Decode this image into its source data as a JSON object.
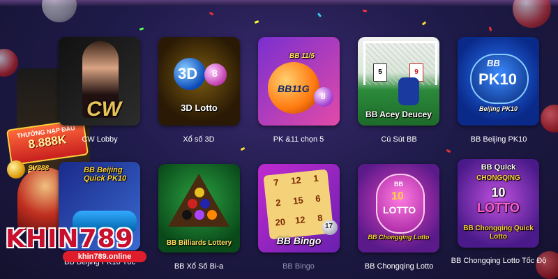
{
  "promo": {
    "line1": "THƯỞNG NẠP ĐẦU",
    "line2": "8.888K",
    "sv_logo": "SV388"
  },
  "games": [
    {
      "label": "CW Lobby",
      "art": "CW",
      "dim": false
    },
    {
      "label": "Xổ số 3D",
      "art": "3D Lotto",
      "dim": false
    },
    {
      "label": "PK &11 chọn 5",
      "art": "BB 11/5",
      "dim": false
    },
    {
      "label": "Cú Sút BB",
      "art": "BB Acey Deucey",
      "dim": false
    },
    {
      "label": "BB Beijing PK10",
      "art": "Beijing PK10",
      "dim": false
    },
    {
      "label": "BB Beijing PK10 Tốc",
      "art": "BB Beijing Quick PK10",
      "dim": false
    },
    {
      "label": "BB Xổ Số Bi-a",
      "art": "BB Billiards Lottery",
      "dim": false
    },
    {
      "label": "BB Bingo",
      "art": "BB Bingo",
      "dim": true
    },
    {
      "label": "BB Chongqing Lotto",
      "art": "BB Chongqing Lotto",
      "dim": false
    },
    {
      "label": "BB Chongqing Lotto Tốc Độ",
      "art": "BB Chongqing Quick Lotto",
      "dim": false
    }
  ],
  "art_extras": {
    "bb115_logo": "BB11G",
    "pk10_logo": "PK10",
    "bb_prefix": "BB",
    "cq_quick_top": "BB Quick",
    "cq_word": "CHONGQING",
    "lotto_word": "LOTTO",
    "lotto_ball_num": "10",
    "ball_8": "8",
    "ball_9": "9",
    "ball_17": "17",
    "bingo_nums": [
      "7",
      "12",
      "1",
      "2",
      "15",
      "6",
      "20",
      "12",
      "8",
      "17"
    ],
    "card_5": "5",
    "card_9": "9"
  },
  "watermark": {
    "brand": "KHIN789",
    "url": "khin789.online"
  },
  "colors": {
    "background": "#1f1b4a",
    "label_text": "#ffffff",
    "label_dim": "#8f8fb0",
    "watermark_red": "#c8102e"
  }
}
